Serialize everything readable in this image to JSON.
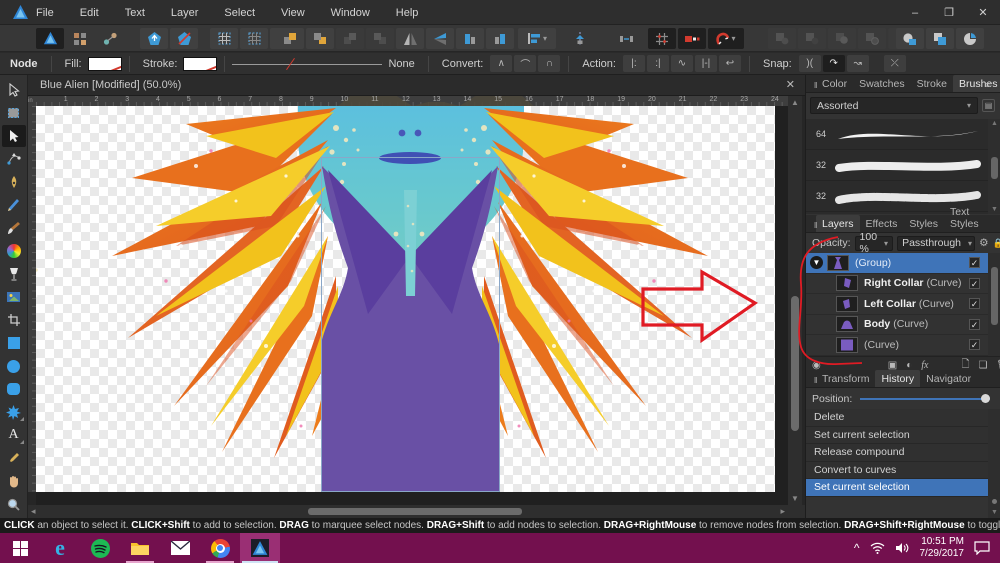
{
  "app": {
    "name": "Affinity Designer",
    "accent_color": "#36a3e8"
  },
  "titlebar": {
    "menus": [
      "File",
      "Edit",
      "Text",
      "Layer",
      "Select",
      "View",
      "Window",
      "Help"
    ],
    "minimize": "–",
    "restore": "❐",
    "close": "✕"
  },
  "contextbar": {
    "tool_label": "Node",
    "fill_label": "Fill:",
    "stroke_label": "Stroke:",
    "stroke_width_value": "None",
    "convert_label": "Convert:",
    "action_label": "Action:",
    "snap_label": "Snap:"
  },
  "document": {
    "tab_title": "Blue Alien [Modified] (50.0%)",
    "close_glyph": "✕",
    "ruler_unit": "in"
  },
  "ruler": {
    "numbers": [
      1,
      2,
      3,
      4,
      5,
      6,
      7,
      8,
      9,
      10,
      11,
      12,
      13,
      14,
      15,
      16,
      17,
      18,
      19,
      20,
      21,
      22,
      23,
      24
    ]
  },
  "panels": {
    "brushes": {
      "tabs": [
        "Color",
        "Swatches",
        "Stroke",
        "Brushes"
      ],
      "active_tab": "Brushes",
      "category": "Assorted",
      "items": [
        {
          "size": "64"
        },
        {
          "size": "32"
        },
        {
          "size": "32"
        }
      ]
    },
    "layers": {
      "tabs": [
        "Layers",
        "Effects",
        "Styles",
        "Text Styles"
      ],
      "active_tab": "Layers",
      "opacity_label": "Opacity:",
      "opacity_value": "100 %",
      "blend_mode": "Passthrough",
      "items": [
        {
          "name": "",
          "type": "(Group)",
          "selected": true,
          "expanded": true
        },
        {
          "name": "Right Collar",
          "type": "(Curve)",
          "selected": false
        },
        {
          "name": "Left Collar",
          "type": "(Curve)",
          "selected": false
        },
        {
          "name": "Body",
          "type": "(Curve)",
          "selected": false
        },
        {
          "name": "",
          "type": "(Curve)",
          "selected": false
        }
      ],
      "fx_label": "fx"
    },
    "history": {
      "tabs": [
        "Transform",
        "History",
        "Navigator"
      ],
      "active_tab": "History",
      "position_label": "Position:",
      "items": [
        "Delete",
        "Set current selection",
        "Release compound",
        "Convert to curves",
        "Set current selection"
      ],
      "selected_index": 4
    }
  },
  "statusbar": {
    "segments": [
      {
        "text": "CLICK",
        "bold": true
      },
      {
        "text": " an object to select it. ",
        "bold": false
      },
      {
        "text": "CLICK+Shift",
        "bold": true
      },
      {
        "text": " to add to selection. ",
        "bold": false
      },
      {
        "text": "DRAG",
        "bold": true
      },
      {
        "text": " to marquee select nodes. ",
        "bold": false
      },
      {
        "text": "DRAG+Shift",
        "bold": true
      },
      {
        "text": " to add nodes to selection. ",
        "bold": false
      },
      {
        "text": "DRAG+RightMouse",
        "bold": true
      },
      {
        "text": " to remove nodes from selection. ",
        "bold": false
      },
      {
        "text": "DRAG+Shift+RightMouse",
        "bold": true
      },
      {
        "text": " to toggle node selection.",
        "bold": false
      }
    ]
  },
  "taskbar": {
    "clock_time": "10:51 PM",
    "clock_date": "7/29/2017",
    "bar_color": "#73104e",
    "active_app": "Affinity Designer"
  },
  "colors": {
    "selection_blue": "#3f74b8",
    "annotation_red": "#e01b24",
    "artwork_orange": "#e56a1d",
    "artwork_yellow": "#f2c21c",
    "artwork_purple": "#6950a5",
    "artwork_teal": "#62c4d9"
  }
}
